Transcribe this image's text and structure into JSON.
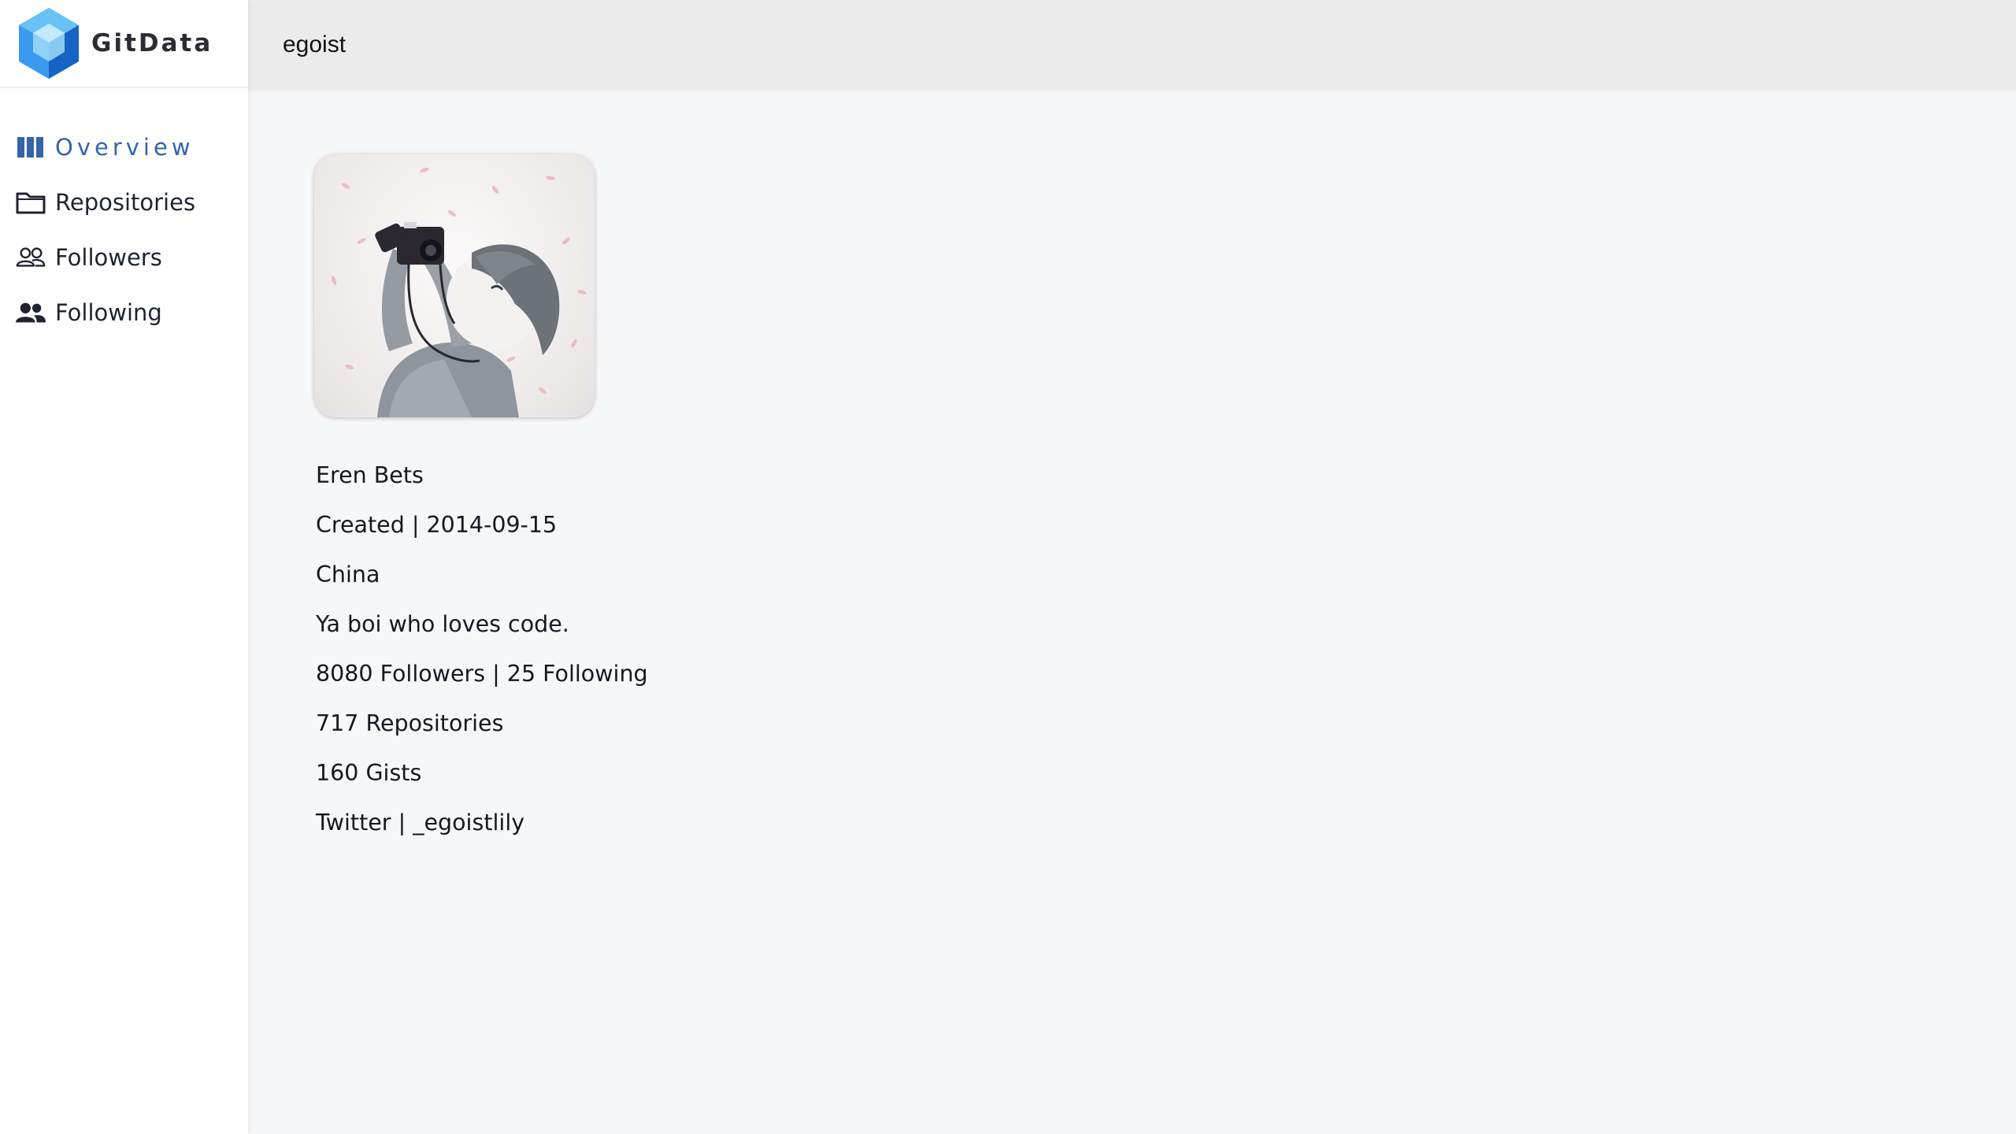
{
  "brand": {
    "name": "GitData",
    "accent": "#2d8be0"
  },
  "sidebar": {
    "items": [
      {
        "label": "Overview",
        "icon": "columns-icon",
        "active": true
      },
      {
        "label": "Repositories",
        "icon": "folder-icon",
        "active": false
      },
      {
        "label": "Followers",
        "icon": "people-outline-icon",
        "active": false
      },
      {
        "label": "Following",
        "icon": "people-filled-icon",
        "active": false
      }
    ],
    "active_color": "#3563ad"
  },
  "header": {
    "username": "egoist"
  },
  "profile": {
    "name": "Eren Bets",
    "created": "Created | 2014-09-15",
    "location": "China",
    "bio": "Ya boi who loves code.",
    "social": "8080 Followers | 25 Following",
    "repositories": "717 Repositories",
    "gists": "160 Gists",
    "twitter": "Twitter | _egoistlily"
  }
}
